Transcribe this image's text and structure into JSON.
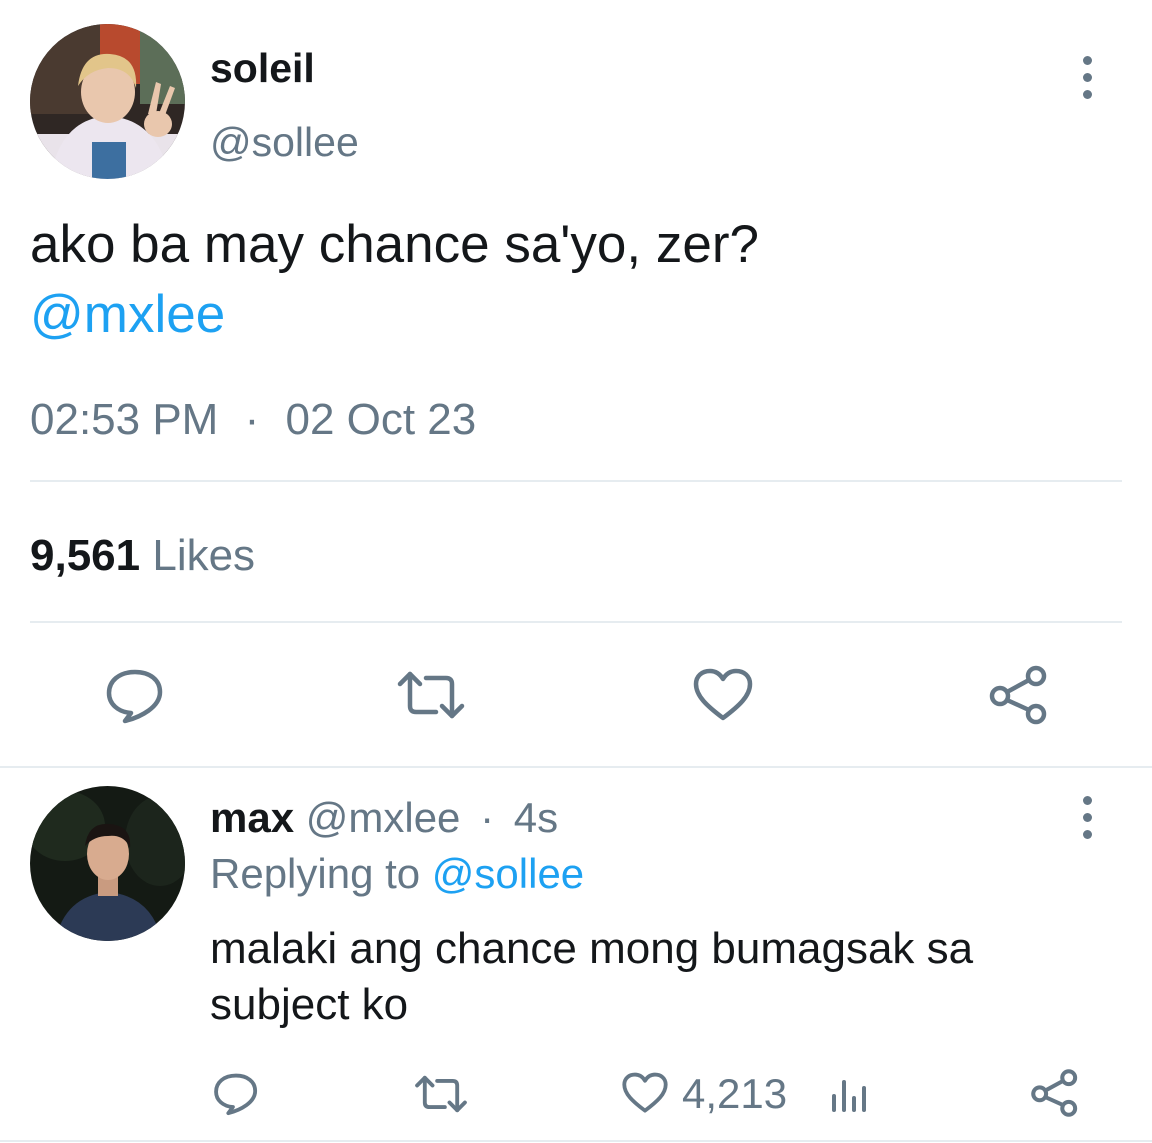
{
  "tweet": {
    "display_name": "soleil",
    "handle": "@sollee",
    "text": "ako ba may chance sa'yo, zer?",
    "mention": "@mxlee",
    "time": "02:53 PM",
    "separator": "·",
    "date": "02 Oct 23",
    "likes_count": "9,561",
    "likes_label": "Likes"
  },
  "reply": {
    "display_name": "max",
    "handle": "@mxlee",
    "separator": "·",
    "age": "4s",
    "replying_label": "Replying to",
    "replying_to": "@sollee",
    "text_line1": "malaki ang chance mong bumagsak sa",
    "text_line2": "subject ko",
    "likes_count": "4,213"
  },
  "colors": {
    "accent": "#1da1f2",
    "secondary_text": "#657786",
    "primary_text": "#14171a",
    "divider": "#e6ecf0"
  },
  "icons": [
    "more-icon",
    "reply-icon",
    "retweet-icon",
    "heart-icon",
    "share-icon",
    "analytics-icon"
  ]
}
